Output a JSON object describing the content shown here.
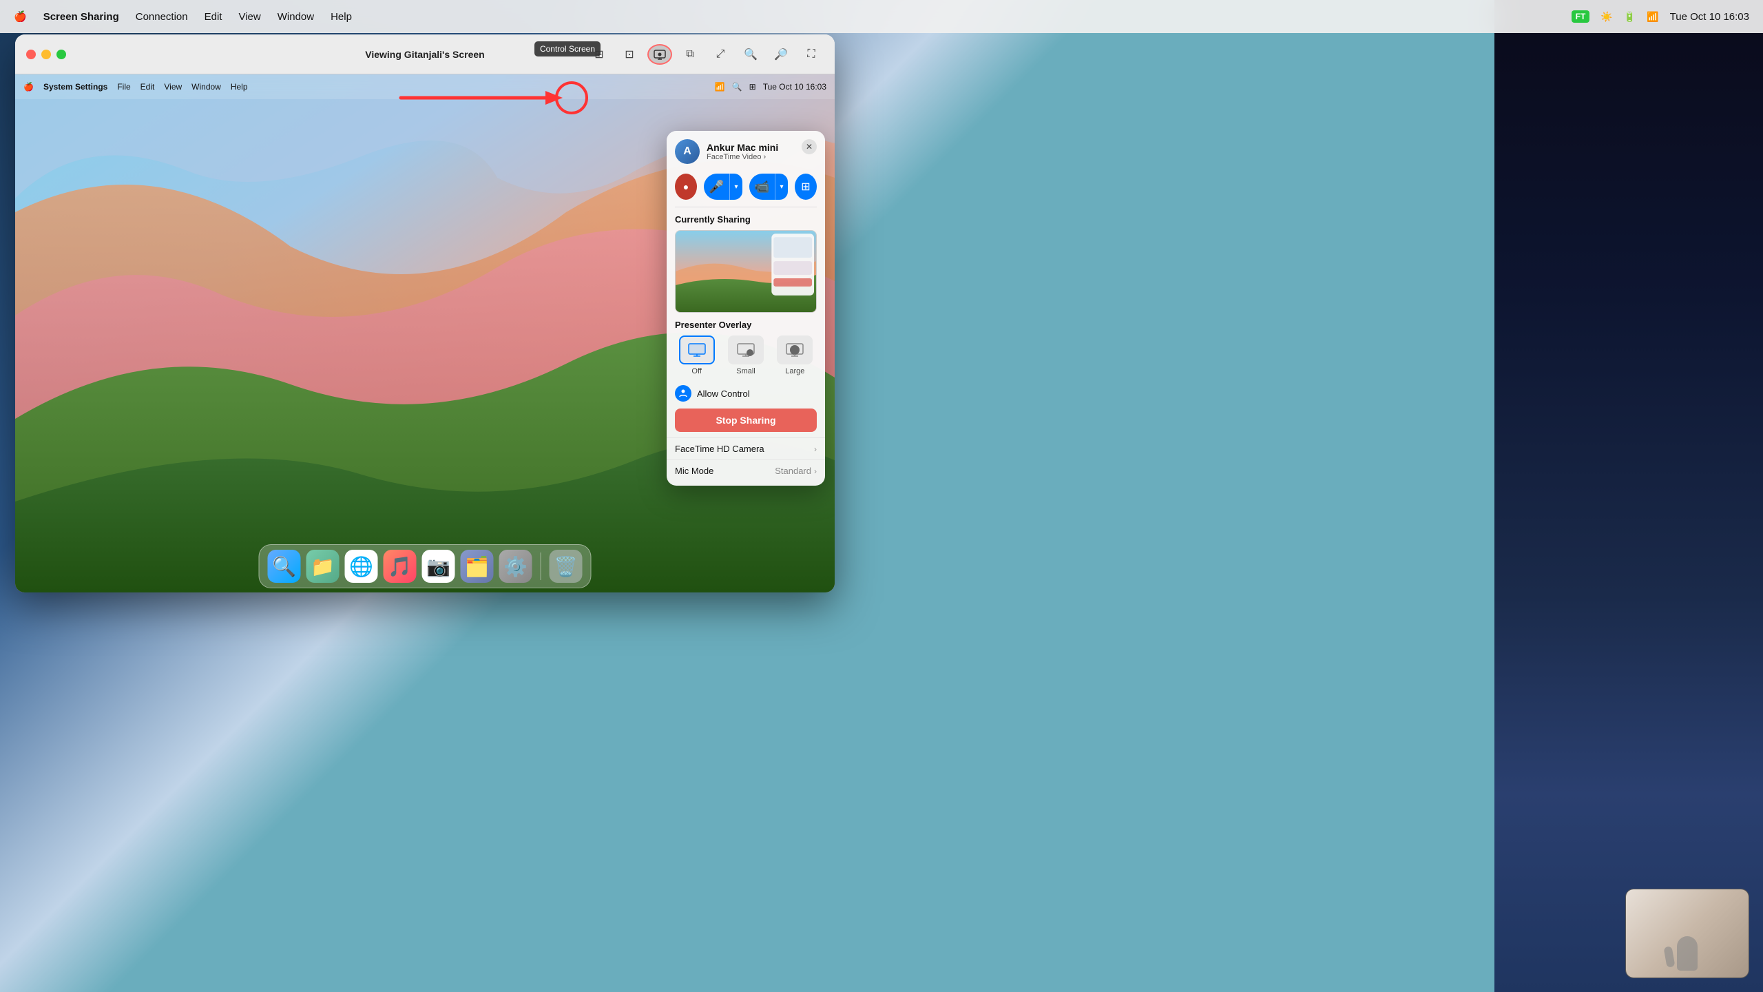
{
  "os": {
    "menubar": {
      "apple_icon": "🍎",
      "app_name": "Screen Sharing",
      "menus": [
        "Connection",
        "Edit",
        "View",
        "Window",
        "Help"
      ],
      "right_items": [
        "wifi",
        "time"
      ],
      "time": "Tue Oct 10  16:03"
    }
  },
  "ss_window": {
    "title": "Viewing Gitanjali's Screen",
    "traffic_lights": {
      "close": "close",
      "minimize": "minimize",
      "maximize": "maximize"
    },
    "toolbar": {
      "control_screen_tooltip": "Control Screen",
      "tools": [
        "grid-view",
        "single-view",
        "pip",
        "zoom-fit",
        "zoom-out",
        "zoom-in",
        "zoom-fullscreen"
      ]
    }
  },
  "shared_desktop": {
    "menubar": {
      "apple": "🍎",
      "app_name": "System Settings",
      "menus": [
        "File",
        "Edit",
        "View",
        "Window",
        "Help"
      ],
      "right_time": "Tue Oct 10  16:03"
    },
    "dock": {
      "icons": [
        "🔍",
        "📁",
        "🌐",
        "🎵",
        "📷",
        "🗂️",
        "⚙️",
        "🗑️"
      ]
    }
  },
  "facetime_panel": {
    "contact_name": "Ankur Mac mini",
    "subtitle": "FaceTime Video",
    "subtitle_arrow": "›",
    "close_label": "×",
    "controls": {
      "dot_btn": "●",
      "mic_btn": "🎤",
      "mic_dropdown": "▾",
      "camera_btn": "📷",
      "camera_dropdown": "▾",
      "screen_share_btn": "⊞"
    },
    "currently_sharing_label": "Currently Sharing",
    "presenter_overlay_label": "Presenter Overlay",
    "presenter_options": [
      {
        "label": "Off",
        "icon": "🖥️",
        "selected": true
      },
      {
        "label": "Small",
        "icon": "👤",
        "selected": false
      },
      {
        "label": "Large",
        "icon": "👤",
        "selected": false
      }
    ],
    "allow_control_label": "Allow Control",
    "stop_sharing_label": "Stop Sharing",
    "facetime_camera_label": "FaceTime HD Camera",
    "mic_mode_label": "Mic Mode",
    "mic_mode_value": "Standard"
  },
  "arrow": {
    "color": "#ff3333"
  },
  "tooltip": {
    "text": "Control Screen"
  }
}
